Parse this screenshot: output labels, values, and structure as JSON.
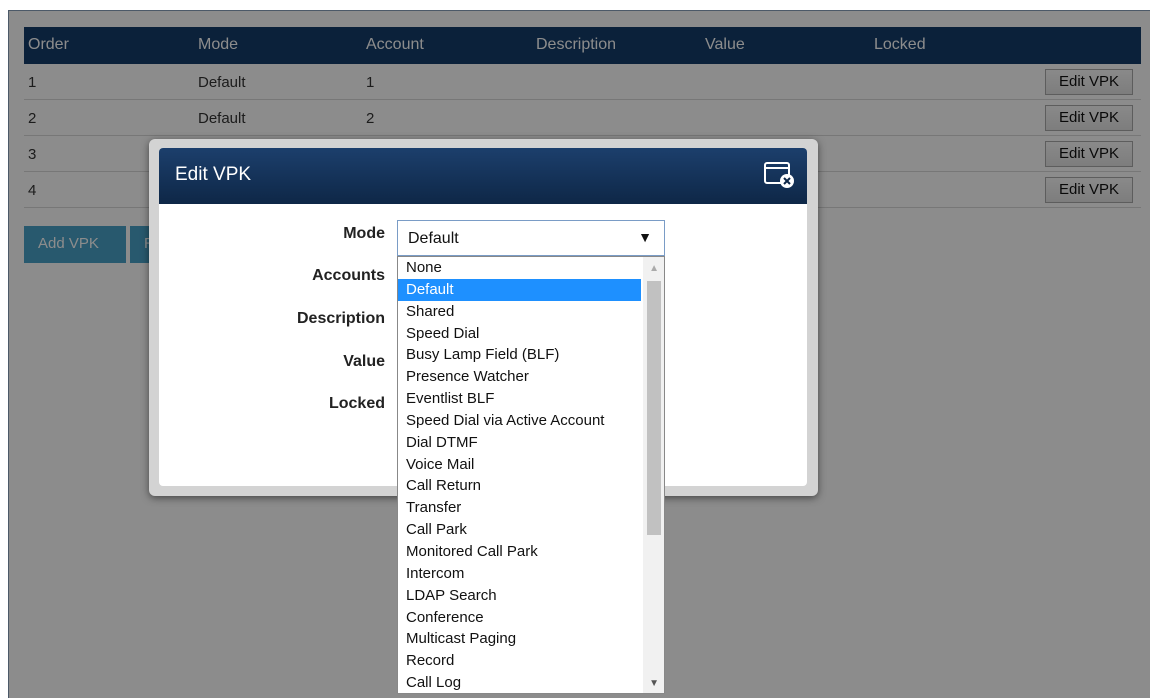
{
  "table": {
    "headers": [
      "Order",
      "Mode",
      "Account",
      "Description",
      "Value",
      "Locked"
    ],
    "rows": [
      {
        "order": "1",
        "mode": "Default",
        "account": "1",
        "edit": "Edit VPK"
      },
      {
        "order": "2",
        "mode": "Default",
        "account": "2",
        "edit": "Edit VPK"
      },
      {
        "order": "3",
        "mode": "",
        "account": "",
        "edit": "Edit VPK"
      },
      {
        "order": "4",
        "mode": "",
        "account": "",
        "edit": "Edit VPK"
      }
    ]
  },
  "buttons": {
    "add": "Add VPK",
    "second_partial": "R"
  },
  "modal": {
    "title": "Edit VPK",
    "labels": {
      "mode": "Mode",
      "accounts": "Accounts",
      "description": "Description",
      "value": "Value",
      "locked": "Locked"
    },
    "mode_select": {
      "value": "Default",
      "arrow": "▼"
    }
  },
  "dropdown": {
    "options": [
      "None",
      "Default",
      "Shared",
      "Speed Dial",
      "Busy Lamp Field (BLF)",
      "Presence Watcher",
      "Eventlist BLF",
      "Speed Dial via Active Account",
      "Dial DTMF",
      "Voice Mail",
      "Call Return",
      "Transfer",
      "Call Park",
      "Monitored Call Park",
      "Intercom",
      "LDAP Search",
      "Conference",
      "Multicast Paging",
      "Record",
      "Call Log"
    ],
    "selected_index": 1,
    "scroll_up": "▲",
    "scroll_down": "▼"
  },
  "colors": {
    "header": "#143d6b",
    "accent_button": "#4aa3c9",
    "selection": "#1e90ff"
  }
}
